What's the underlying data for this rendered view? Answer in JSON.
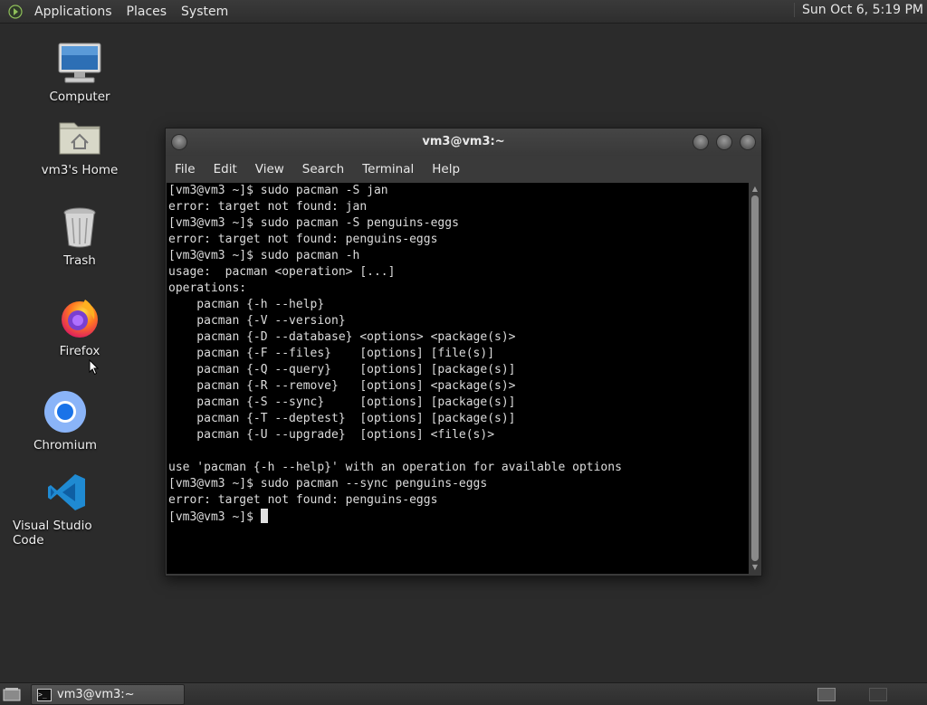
{
  "top_panel": {
    "menus": [
      "Applications",
      "Places",
      "System"
    ],
    "clock": "Sun Oct  6, 5:19 PM"
  },
  "desktop_icons": [
    {
      "label": "Computer",
      "icon": "computer-icon"
    },
    {
      "label": "vm3's Home",
      "icon": "home-folder-icon"
    },
    {
      "label": "Trash",
      "icon": "trash-icon"
    },
    {
      "label": "Firefox",
      "icon": "firefox-icon"
    },
    {
      "label": "Chromium",
      "icon": "chromium-icon"
    },
    {
      "label": "Visual Studio Code",
      "icon": "vscode-icon"
    }
  ],
  "terminal": {
    "title": "vm3@vm3:~",
    "menu": [
      "File",
      "Edit",
      "View",
      "Search",
      "Terminal",
      "Help"
    ],
    "lines": [
      "[vm3@vm3 ~]$ sudo pacman -S jan",
      "error: target not found: jan",
      "[vm3@vm3 ~]$ sudo pacman -S penguins-eggs",
      "error: target not found: penguins-eggs",
      "[vm3@vm3 ~]$ sudo pacman -h",
      "usage:  pacman <operation> [...]",
      "operations:",
      "    pacman {-h --help}",
      "    pacman {-V --version}",
      "    pacman {-D --database} <options> <package(s)>",
      "    pacman {-F --files}    [options] [file(s)]",
      "    pacman {-Q --query}    [options] [package(s)]",
      "    pacman {-R --remove}   [options] <package(s)>",
      "    pacman {-S --sync}     [options] [package(s)]",
      "    pacman {-T --deptest}  [options] [package(s)]",
      "    pacman {-U --upgrade}  [options] <file(s)>",
      "",
      "use 'pacman {-h --help}' with an operation for available options",
      "[vm3@vm3 ~]$ sudo pacman --sync penguins-eggs",
      "error: target not found: penguins-eggs"
    ],
    "prompt": "[vm3@vm3 ~]$ "
  },
  "taskbar": {
    "window_label": "vm3@vm3:~"
  }
}
